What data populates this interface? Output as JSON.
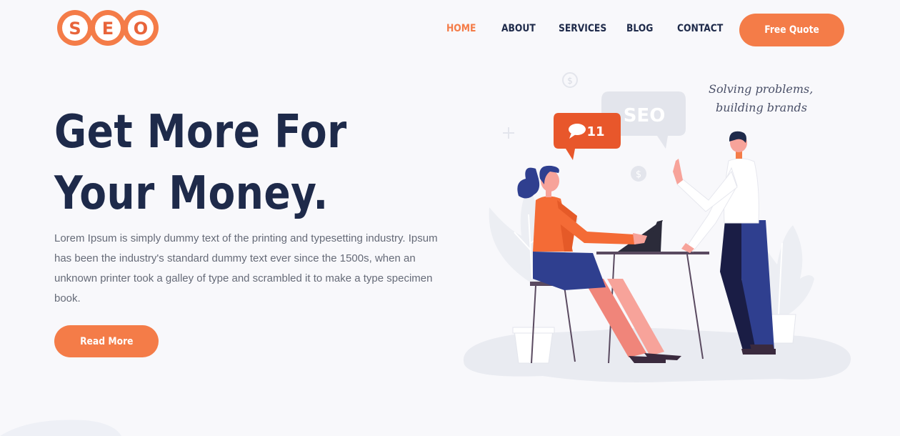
{
  "logo": {
    "letters": [
      "S",
      "E",
      "O"
    ]
  },
  "nav": {
    "items": [
      {
        "label": "HOME",
        "active": true
      },
      {
        "label": "ABOUT",
        "active": false
      },
      {
        "label": "SERVICES",
        "active": false
      },
      {
        "label": "BLOG",
        "active": false
      },
      {
        "label": "CONTACT",
        "active": false
      }
    ],
    "cta_label": "Free Quote"
  },
  "hero": {
    "title_line1": "Get More For",
    "title_line2": "Your Money.",
    "description": "Lorem Ipsum is simply dummy text of the printing and typesetting industry. Ipsum has been the industry's standard dummy text ever since the 1500s, when an unknown printer took a galley of type and scrambled it to make a type specimen book.",
    "button_label": "Read More"
  },
  "illustration": {
    "bubble_seo": "SEO",
    "notification_count": "11",
    "tagline_line1": "Solving problems,",
    "tagline_line2": "building brands"
  },
  "colors": {
    "accent": "#f47c48",
    "navy": "#1e2a4a",
    "body_text": "#666b78",
    "background": "#f8f8fb"
  }
}
